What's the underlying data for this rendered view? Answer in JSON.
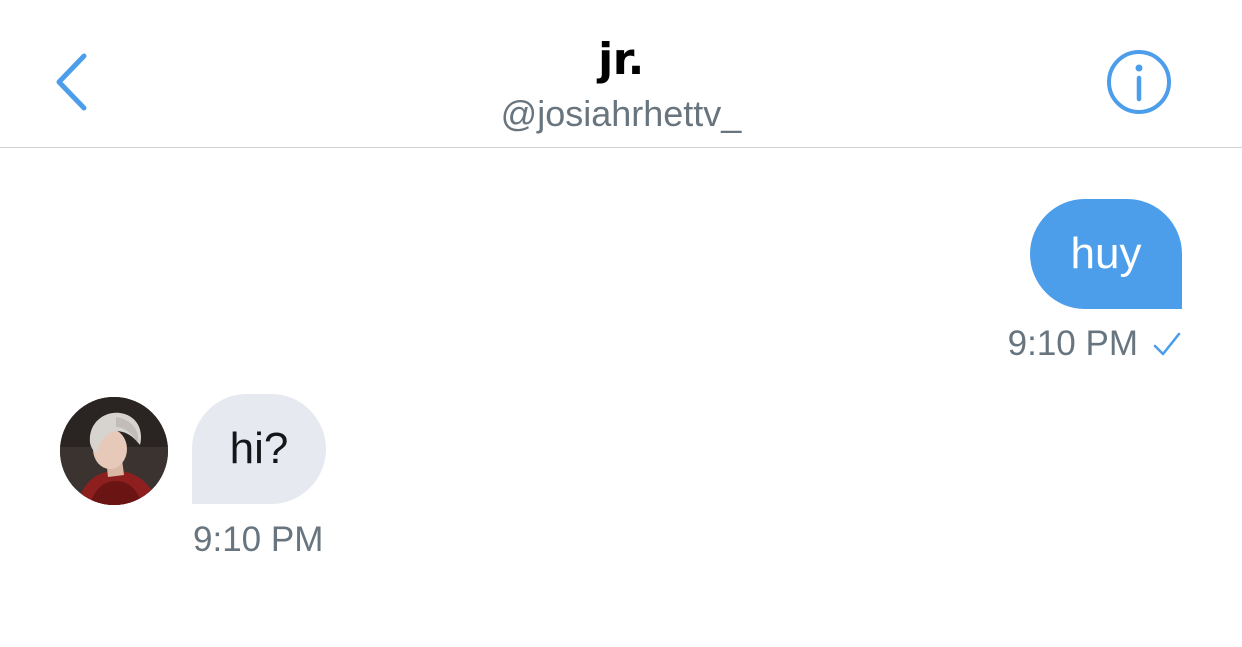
{
  "header": {
    "title": "jr.",
    "handle": "@josiahrhettv_",
    "back_icon": "chevron-left-icon",
    "info_icon": "info-circle-icon",
    "accent_color": "#4c9eeb"
  },
  "messages": [
    {
      "direction": "outgoing",
      "text": "huy",
      "time": "9:10 PM",
      "status_icon": "checkmark-icon",
      "bubble_color": "#4c9eeb"
    },
    {
      "direction": "incoming",
      "text": "hi?",
      "time": "9:10 PM",
      "avatar_icon": "avatar",
      "bubble_color": "#e6e9ef"
    }
  ]
}
